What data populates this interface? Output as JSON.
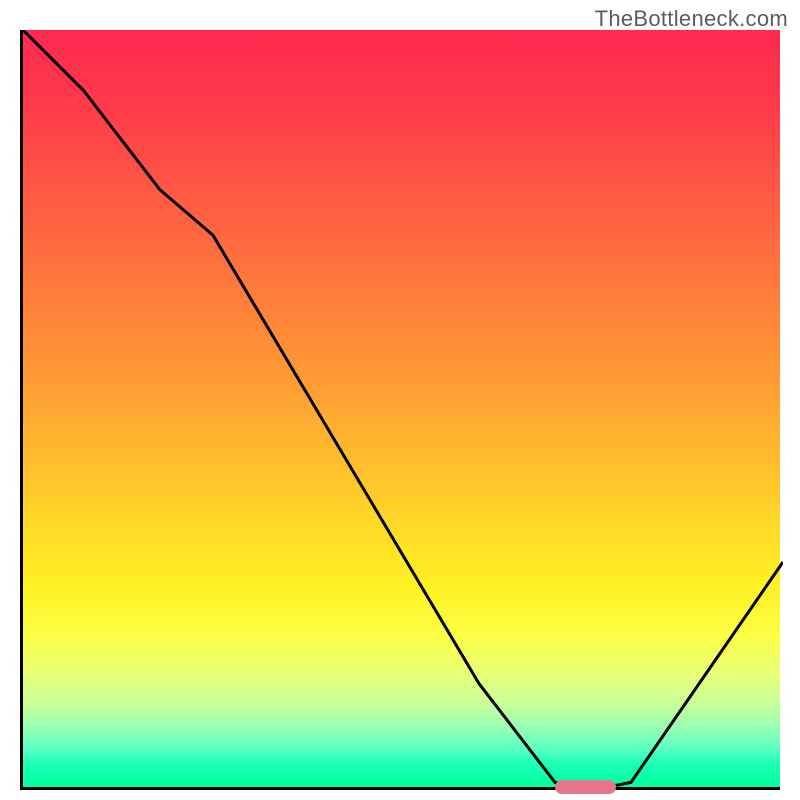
{
  "watermark": "TheBottleneck.com",
  "chart_data": {
    "type": "line",
    "title": "",
    "xlabel": "",
    "ylabel": "",
    "xlim": [
      0,
      100
    ],
    "ylim": [
      0,
      100
    ],
    "x": [
      0,
      8,
      18,
      25,
      60,
      70,
      75,
      80,
      100
    ],
    "values": [
      100,
      92,
      79,
      73,
      14,
      1,
      0,
      1,
      30
    ],
    "marker": {
      "x_start": 70,
      "x_end": 78,
      "y": 0
    },
    "note": "values read off the visual as approximate percentages"
  }
}
